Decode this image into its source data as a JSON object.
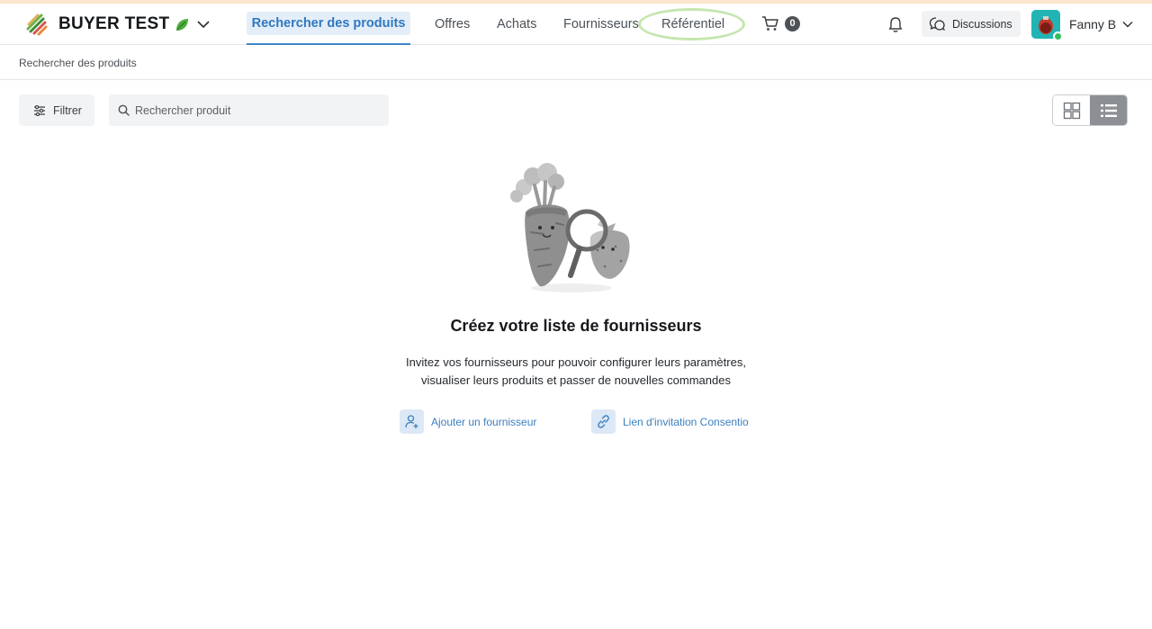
{
  "header": {
    "brand_name": "BUYER TEST",
    "nav": {
      "search_products": "Rechercher des produits",
      "offers": "Offres",
      "purchases": "Achats",
      "suppliers": "Fournisseurs",
      "referential": "Référentiel"
    },
    "cart_count": "0",
    "discussions_label": "Discussions",
    "user_name": "Fanny B"
  },
  "breadcrumb": "Rechercher des produits",
  "toolbar": {
    "filter_label": "Filtrer",
    "search_placeholder": "Rechercher produit",
    "active_view": "list"
  },
  "empty_state": {
    "title": "Créez votre liste de fournisseurs",
    "description_line1": "Invitez vos fournisseurs pour pouvoir configurer leurs paramètres,",
    "description_line2": "visualiser leurs produits et passer de nouvelles commandes",
    "add_supplier_label": "Ajouter un fournisseur",
    "invite_link_label": "Lien d'invitation Consentio"
  },
  "colors": {
    "accent": "#3f86c7",
    "active_nav_bg": "#e4eef8",
    "online": "#2ec05a",
    "highlight_ring": "#c5e6b0"
  },
  "icons": [
    "brand-logo-icon",
    "leaf-icon",
    "chevron-down-icon",
    "cart-icon",
    "bell-icon",
    "chat-icon",
    "filter-sliders-icon",
    "search-icon",
    "grid-view-icon",
    "list-view-icon",
    "add-user-icon",
    "link-icon"
  ]
}
